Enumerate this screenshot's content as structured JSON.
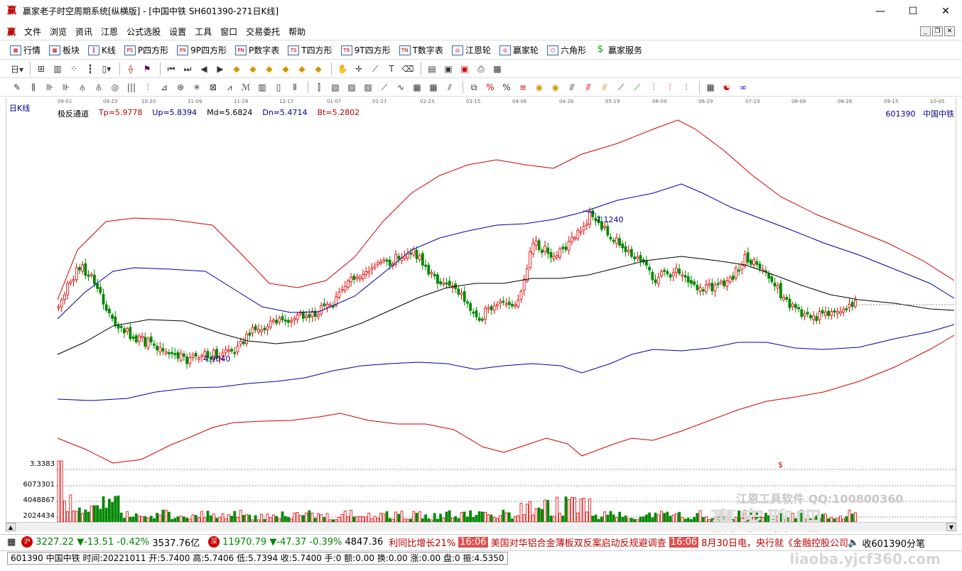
{
  "window": {
    "title": "赢家老子时空周期系统[纵横版] - [中国中铁  SH601390-271日K线]",
    "controls": [
      "—",
      "☐",
      "✕"
    ]
  },
  "menu": {
    "items": [
      "文件",
      "浏览",
      "资讯",
      "江恩",
      "公式选股",
      "设置",
      "工具",
      "窗口",
      "交易委托",
      "帮助"
    ]
  },
  "toolbar1": {
    "items": [
      {
        "label": "行情",
        "icon": "grid-icon"
      },
      {
        "label": "板块",
        "icon": "blocks-icon"
      },
      {
        "label": "K线",
        "icon": "kline-icon"
      },
      {
        "label": "P四方形",
        "icon": "ps-icon",
        "badge": "PS"
      },
      {
        "label": "9P四方形",
        "icon": "p9-icon",
        "badge": "P9"
      },
      {
        "label": "P数字表",
        "icon": "pn-icon",
        "badge": "PN"
      },
      {
        "label": "T四方形",
        "icon": "ts-icon",
        "badge": "TS"
      },
      {
        "label": "9T四方形",
        "icon": "t9-icon",
        "badge": "T9"
      },
      {
        "label": "T数字表",
        "icon": "tn-icon",
        "badge": "TN"
      },
      {
        "label": "江恩轮",
        "icon": "wheel-icon",
        "badge": "◎"
      },
      {
        "label": "赢家轮",
        "icon": "winner-wheel-icon",
        "badge": "◎"
      },
      {
        "label": "六角形",
        "icon": "hexagon-icon",
        "badge": "⬡"
      },
      {
        "label": "赢家服务",
        "icon": "dollar-icon",
        "badge": "$"
      }
    ]
  },
  "chart": {
    "period_label": "日K线",
    "indicator": {
      "name": "极反通道",
      "tp": "Tp=5.9778",
      "up": "Up=5.8394",
      "md": "Md=5.6824",
      "dn": "Dn=5.4714",
      "bt": "Bt=5.2802"
    },
    "stock_id": "601390",
    "stock_name": "中国中铁",
    "dates": [
      "09-01",
      "09-23",
      "10-20",
      "11-09",
      "11-29",
      "12-17",
      "01-07",
      "01-27",
      "02-23",
      "03-15",
      "04-06",
      "04-26",
      "05-19",
      "06-09",
      "06-29",
      "07-19",
      "08-08",
      "08-26",
      "09-15",
      "10-05"
    ],
    "high_label": "7.1240",
    "low_label": "4.9040",
    "volume_labels": [
      "3.3383",
      "6073301",
      "4048867",
      "2024434"
    ],
    "dollar_mark": "$",
    "colors": {
      "up": "#e00000",
      "down": "#008800",
      "channel_outer": "#d00000",
      "channel_inner": "#0000aa",
      "mid": "#000000"
    }
  },
  "chart_data": {
    "type": "candlestick",
    "title": "",
    "series": [
      {
        "name": "Tp",
        "values": [
          5.9778
        ]
      },
      {
        "name": "Up",
        "values": [
          5.8394
        ]
      },
      {
        "name": "Md",
        "values": [
          5.6824
        ]
      },
      {
        "name": "Dn",
        "values": [
          5.4714
        ]
      },
      {
        "name": "Bt",
        "values": [
          5.2802
        ]
      }
    ],
    "annotations": [
      {
        "label": "7.1240"
      },
      {
        "label": "4.9040"
      }
    ]
  },
  "watermarks": {
    "tool": "江恩工具软件  QQ:100800360",
    "site": "赢家聊吧",
    "url": "liaoba.yjcf360.com"
  },
  "ticker": {
    "sh_value": "3227.22",
    "sh_change": "▼-13.51",
    "sh_pct": "-0.42%",
    "sh_amount": "3537.76亿",
    "sz_value": "11970.79",
    "sz_change": "▼-47.37",
    "sz_pct": "-0.39%",
    "sz_amount": "4847.36",
    "news1": "利同比增长21%",
    "news2_time": "16:06",
    "news2": "美国对华铝合金薄板双反案启动反规避调查",
    "news3_time": "16:06",
    "news3": "8月30日电，央行就《金融控股公司",
    "right_label": "收601390分笔"
  },
  "status": {
    "text": "601390 中国中铁 时间:20221011 开:5.7400 高:5.7406 低:5.7394 收:5.7400 手:0 额:0.00 换:0.00 涨:0.00 盘:0 振:4.5350"
  }
}
